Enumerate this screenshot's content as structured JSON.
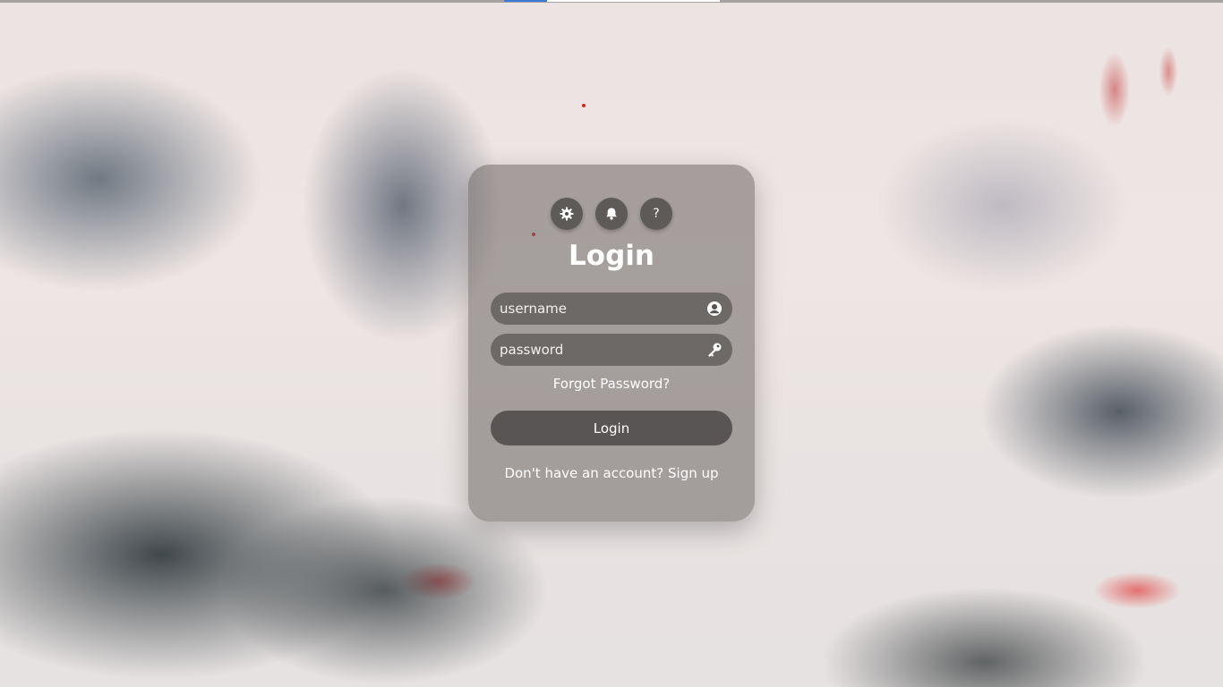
{
  "header": {
    "icons": [
      {
        "name": "gear-icon",
        "label": "⚙"
      },
      {
        "name": "bell-icon",
        "label": "🔔"
      },
      {
        "name": "help-icon",
        "label": "?"
      }
    ]
  },
  "login": {
    "title": "Login",
    "username_placeholder": "username",
    "password_placeholder": "password",
    "forgot_label": "Forgot Password?",
    "submit_label": "Login",
    "signup_prompt": "Don't have an account?",
    "signup_link": "Sign up"
  },
  "colors": {
    "card_background": "#6a6562",
    "button_background": "#4b4948",
    "text": "#ffffff",
    "tab_indicator": "#3b7bd6"
  }
}
